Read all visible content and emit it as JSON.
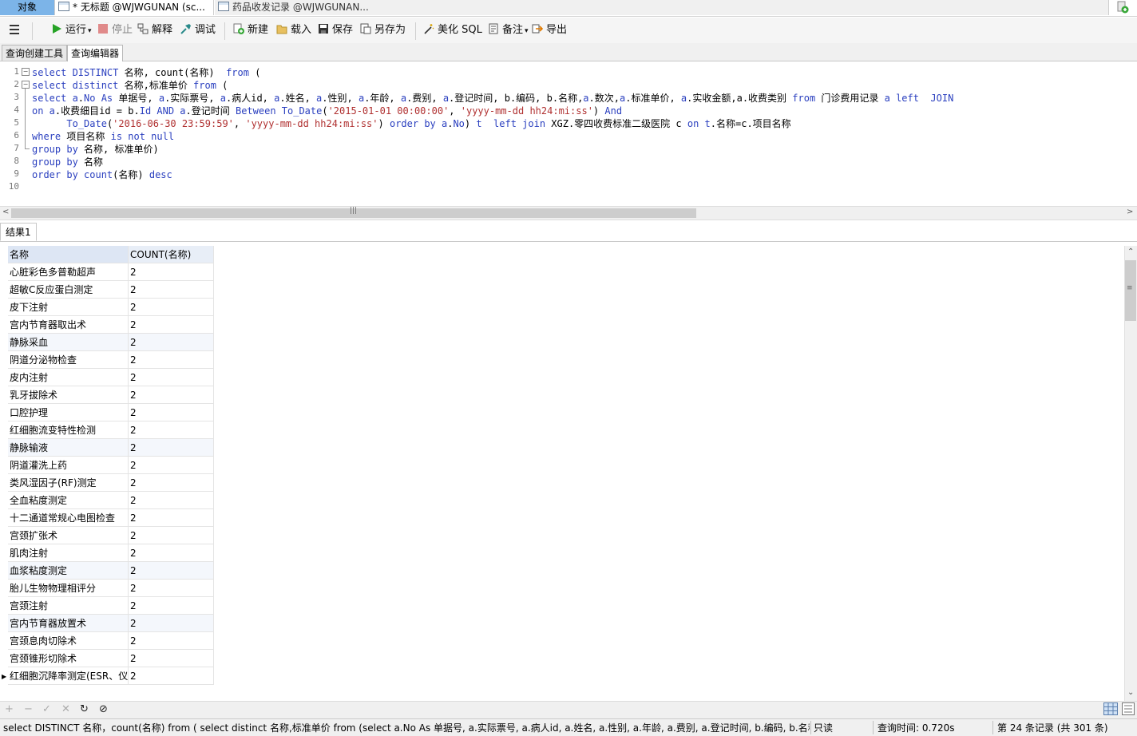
{
  "window_tabs": {
    "objects": "对象",
    "untitled": "* 无标题 @WJWGUNAN (sc...",
    "drug": "药品收发记录 @WJWGUNAN..."
  },
  "toolbar": {
    "run": "运行",
    "stop": "停止",
    "explain": "解释",
    "debug": "调试",
    "new": "新建",
    "load": "载入",
    "save": "保存",
    "save_as": "另存为",
    "beautify": "美化 SQL",
    "comment": "备注",
    "export": "导出"
  },
  "subtabs": {
    "builder": "查询创建工具",
    "editor": "查询编辑器"
  },
  "editor": {
    "line_numbers": [
      "1",
      "2",
      "3",
      "4",
      "5",
      "6",
      "7",
      "8",
      "9",
      "10"
    ],
    "lines": {
      "l1": [
        [
          "kw",
          "select DISTINCT "
        ],
        [
          "t",
          "名称, count(名称)  "
        ],
        [
          "kw",
          "from"
        ],
        [
          "t",
          " ("
        ]
      ],
      "l2": [
        [
          "kw",
          "select distinct "
        ],
        [
          "t",
          "名称,标准单价 "
        ],
        [
          "kw",
          "from"
        ],
        [
          "t",
          " ("
        ]
      ],
      "l3": [
        [
          "kw",
          "select a"
        ],
        [
          "t",
          "."
        ],
        [
          "kw",
          "No As "
        ],
        [
          "t",
          "单据号, "
        ],
        [
          "kw",
          "a"
        ],
        [
          "t",
          ".实际票号, "
        ],
        [
          "kw",
          "a"
        ],
        [
          "t",
          ".病人id, "
        ],
        [
          "kw",
          "a"
        ],
        [
          "t",
          ".姓名, "
        ],
        [
          "kw",
          "a"
        ],
        [
          "t",
          ".性别, "
        ],
        [
          "kw",
          "a"
        ],
        [
          "t",
          ".年龄, "
        ],
        [
          "kw",
          "a"
        ],
        [
          "t",
          ".费别, "
        ],
        [
          "kw",
          "a"
        ],
        [
          "t",
          ".登记时间, b.编码, b.名称,"
        ],
        [
          "kw",
          "a"
        ],
        [
          "t",
          ".数次,"
        ],
        [
          "kw",
          "a"
        ],
        [
          "t",
          ".标准单价, "
        ],
        [
          "kw",
          "a"
        ],
        [
          "t",
          ".实收金额,a.收费类别 "
        ],
        [
          "kw",
          "from"
        ],
        [
          "t",
          " 门诊费用记录 "
        ],
        [
          "kw",
          "a left  JOIN"
        ]
      ],
      "l4": [
        [
          "kw",
          "on a"
        ],
        [
          "t",
          ".收费细目id = b."
        ],
        [
          "kw",
          "Id AND a"
        ],
        [
          "t",
          ".登记时间 "
        ],
        [
          "kw",
          "Between To_Date"
        ],
        [
          "t",
          "("
        ],
        [
          "str",
          "'2015-01-01 00:00:00'"
        ],
        [
          "t",
          ", "
        ],
        [
          "str",
          "'yyyy-mm-dd hh24:mi:ss'"
        ],
        [
          "t",
          ") "
        ],
        [
          "kw",
          "And"
        ]
      ],
      "l5": [
        [
          "t",
          "      "
        ],
        [
          "kw",
          "To_Date"
        ],
        [
          "t",
          "("
        ],
        [
          "str",
          "'2016-06-30 23:59:59'"
        ],
        [
          "t",
          ", "
        ],
        [
          "str",
          "'yyyy-mm-dd hh24:mi:ss'"
        ],
        [
          "t",
          ") "
        ],
        [
          "kw",
          "order by a"
        ],
        [
          "t",
          "."
        ],
        [
          "kw",
          "No"
        ],
        [
          "t",
          ") "
        ],
        [
          "kw",
          "t  left join "
        ],
        [
          "t",
          "XGZ.零四收费标准二级医院 c "
        ],
        [
          "kw",
          "on t"
        ],
        [
          "t",
          ".名称=c.项目名称"
        ]
      ],
      "l6": [
        [
          "kw",
          "where "
        ],
        [
          "t",
          "项目名称 "
        ],
        [
          "kw",
          "is not null"
        ]
      ],
      "l7": [
        [
          "kw",
          "group by "
        ],
        [
          "t",
          "名称, 标准单价)"
        ]
      ],
      "l8": [
        [
          "kw",
          "group by "
        ],
        [
          "t",
          "名称"
        ]
      ],
      "l9": [
        [
          "kw",
          "order by count"
        ],
        [
          "t",
          "(名称) "
        ],
        [
          "kw",
          "desc"
        ]
      ],
      "l10": []
    }
  },
  "result_tab": "结果1",
  "grid": {
    "columns": [
      "名称",
      "COUNT(名称)"
    ],
    "rows": [
      [
        "心脏彩色多普勒超声",
        "2"
      ],
      [
        "超敏C反应蛋白测定",
        "2"
      ],
      [
        "皮下注射",
        "2"
      ],
      [
        "宫内节育器取出术",
        "2"
      ],
      [
        "静脉采血",
        "2"
      ],
      [
        "阴道分泌物检查",
        "2"
      ],
      [
        "皮内注射",
        "2"
      ],
      [
        "乳牙拔除术",
        "2"
      ],
      [
        "口腔护理",
        "2"
      ],
      [
        "红细胞流变特性检测",
        "2"
      ],
      [
        "静脉输液",
        "2"
      ],
      [
        "阴道灌洗上药",
        "2"
      ],
      [
        "类风湿因子(RF)测定",
        "2"
      ],
      [
        "全血粘度测定",
        "2"
      ],
      [
        "十二通道常规心电图检查",
        "2"
      ],
      [
        "宫颈扩张术",
        "2"
      ],
      [
        "肌肉注射",
        "2"
      ],
      [
        "血浆粘度测定",
        "2"
      ],
      [
        "胎儿生物物理相评分",
        "2"
      ],
      [
        "宫颈注射",
        "2"
      ],
      [
        "宫内节育器放置术",
        "2"
      ],
      [
        "宫颈息肉切除术",
        "2"
      ],
      [
        "宫颈锥形切除术",
        "2"
      ],
      [
        "红细胞沉降率测定(ESR、仪",
        "2"
      ]
    ]
  },
  "status": {
    "sql": "select DISTINCT 名称，count(名称)  from ( select distinct 名称,标准单价 from (select a.No As 单据号, a.实际票号, a.病人id, a.姓名, a.性别, a.年龄, a.费别, a.登记时间, b.编码, b.名称,a.",
    "readonly": "只读",
    "query_time": "查询时间: 0.720s",
    "records": "第 24 条记录 (共 301 条)"
  },
  "colors": {
    "keyword": "#2a3fbf",
    "string": "#b03030",
    "active_window_tab": "#7cb4e8",
    "header_bg": "#dde6f4"
  }
}
